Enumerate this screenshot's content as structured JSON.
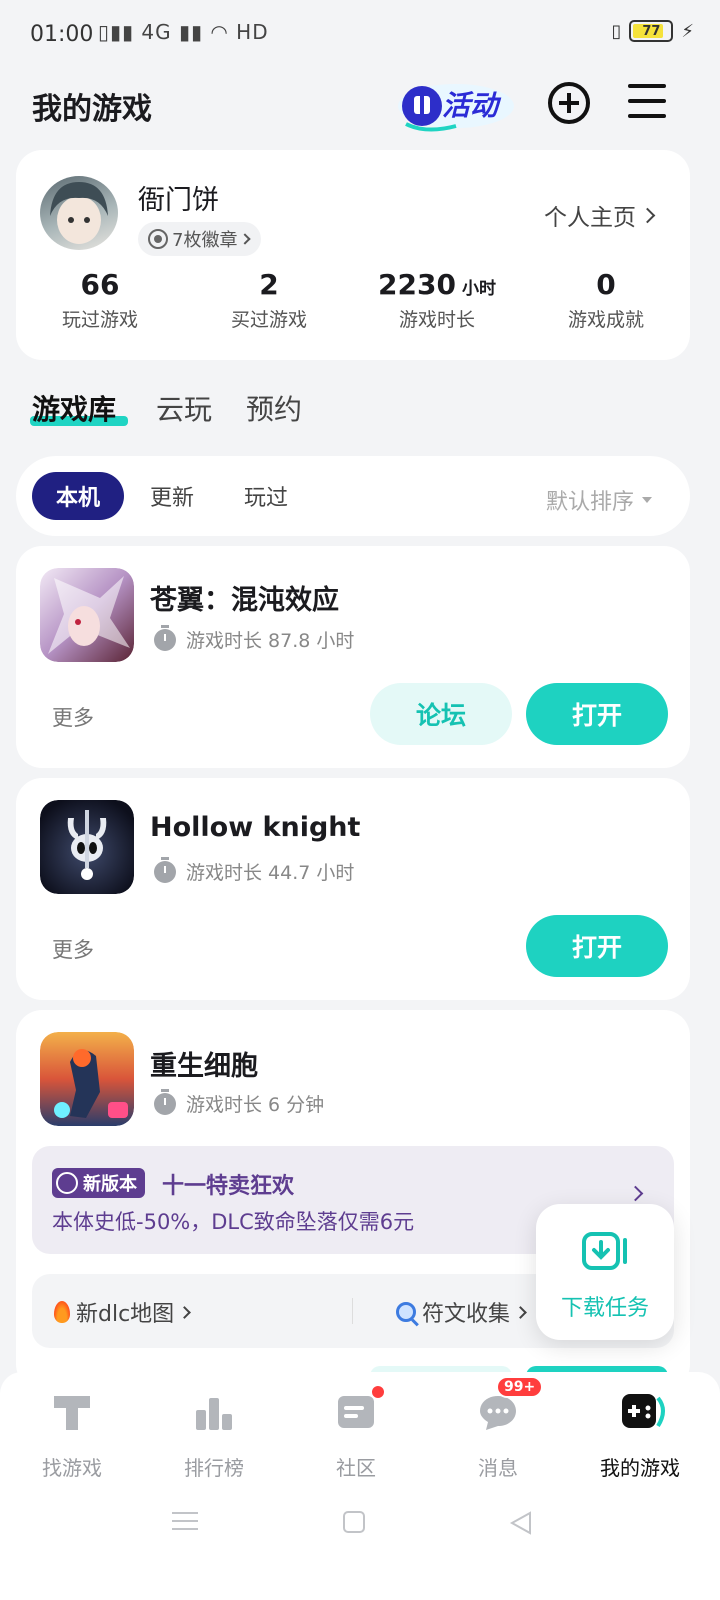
{
  "status_bar": {
    "time": "01:00",
    "network": "4G",
    "wifi_label": "HD",
    "battery": "77"
  },
  "header": {
    "title": "我的游戏",
    "activity_label": "活动"
  },
  "profile": {
    "username": "衙门饼",
    "badges_label": "7枚徽章",
    "homepage_label": "个人主页",
    "stats": [
      {
        "value": "66",
        "unit": "",
        "label": "玩过游戏"
      },
      {
        "value": "2",
        "unit": "",
        "label": "买过游戏"
      },
      {
        "value": "2230",
        "unit": "小时",
        "label": "游戏时长"
      },
      {
        "value": "0",
        "unit": "",
        "label": "游戏成就"
      }
    ]
  },
  "library_tabs": [
    "游戏库",
    "云玩",
    "预约"
  ],
  "filters": {
    "chips": [
      "本机",
      "更新",
      "玩过"
    ],
    "sort_label": "默认排序"
  },
  "games": [
    {
      "title": "苍翼：混沌效应",
      "playtime": "游戏时长 87.8 小时",
      "more_label": "更多",
      "forum_label": "论坛",
      "open_label": "打开"
    },
    {
      "title": "Hollow knight",
      "playtime": "游戏时长 44.7 小时",
      "more_label": "更多",
      "open_label": "打开"
    },
    {
      "title": "重生细胞",
      "playtime": "游戏时长 6 分钟",
      "promo": {
        "tag": "新版本",
        "title": "十一特卖狂欢",
        "description": "本体史低-50%，DLC致命坠落仅需6元"
      },
      "tags": [
        "新dlc地图",
        "符文收集"
      ]
    }
  ],
  "float_download": {
    "label": "下载任务"
  },
  "bottom_nav": [
    {
      "label": "找游戏",
      "icon": "find-game-icon"
    },
    {
      "label": "排行榜",
      "icon": "ranking-icon"
    },
    {
      "label": "社区",
      "icon": "community-icon"
    },
    {
      "label": "消息",
      "icon": "message-icon",
      "badge": "99+"
    },
    {
      "label": "我的游戏",
      "icon": "gamepad-icon"
    }
  ],
  "colors": {
    "accent": "#1ed2c1",
    "chip_active": "#202082",
    "promo": "#5e3d90"
  }
}
